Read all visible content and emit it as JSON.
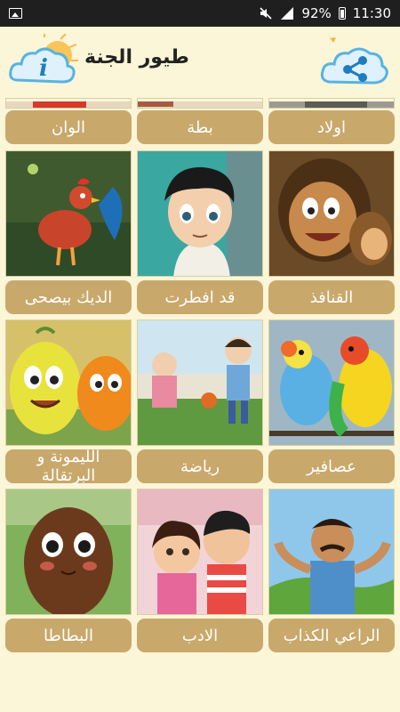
{
  "status_bar": {
    "battery": "92%",
    "time": "11:30"
  },
  "header": {
    "title": "طيور الجنة"
  },
  "grid": {
    "partial_row": [
      "الوان",
      "بطة",
      "اولاد"
    ],
    "rows": [
      [
        "الديك بيصحى",
        "قد افطرت",
        "القنافذ"
      ],
      [
        "الليمونة و البرتقالة",
        "رياضة",
        "عصافير"
      ],
      [
        "البطاطا",
        "الادب",
        "الراعي الكذاب"
      ]
    ]
  },
  "colors": {
    "background": "#fbf6d8",
    "button": "#c9a86b",
    "status_bar": "#1f1f1f"
  }
}
